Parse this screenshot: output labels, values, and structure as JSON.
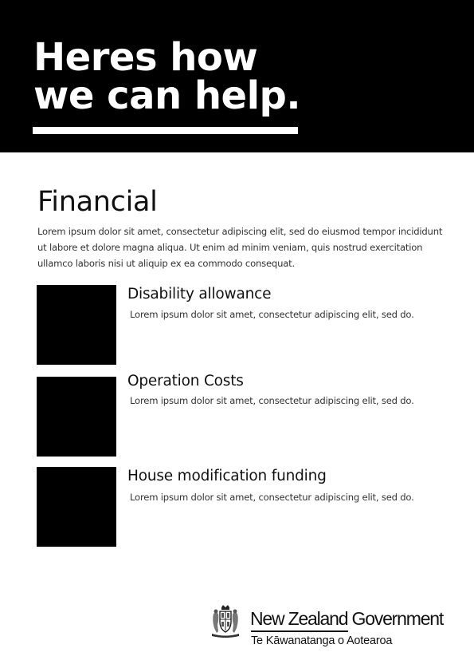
{
  "hero": {
    "title_line1": "Heres how",
    "title_line2": "we can help."
  },
  "section": {
    "title": "Financial",
    "body_lines": [
      "Lorem ipsum dolor sit amet, consectetur adipiscing elit, sed do eiusmod tempor incididunt",
      "ut labore et dolore magna aliqua. Ut enim ad minim veniam, quis nostrud exercitation",
      " ullamco laboris nisi ut aliquip ex ea commodo consequat."
    ]
  },
  "items": [
    {
      "title": "Disability allowance",
      "description": "Lorem ipsum dolor sit amet, consectetur adipiscing elit, sed do."
    },
    {
      "title": "Operation Costs",
      "description": "Lorem ipsum dolor sit amet, consectetur adipiscing elit, sed do."
    },
    {
      "title": "House modification funding",
      "description": "Lorem ipsum dolor sit amet, consectetur adipiscing elit, sed do."
    }
  ],
  "footer": {
    "logo_icon": "nz-coat-of-arms-icon",
    "gov_name": "New Zealand Government",
    "gov_maori": "Te Kāwanatanga o Aotearoa"
  },
  "colors": {
    "hero_bg": "#000000",
    "hero_text": "#ffffff",
    "placeholder": "#000000"
  }
}
